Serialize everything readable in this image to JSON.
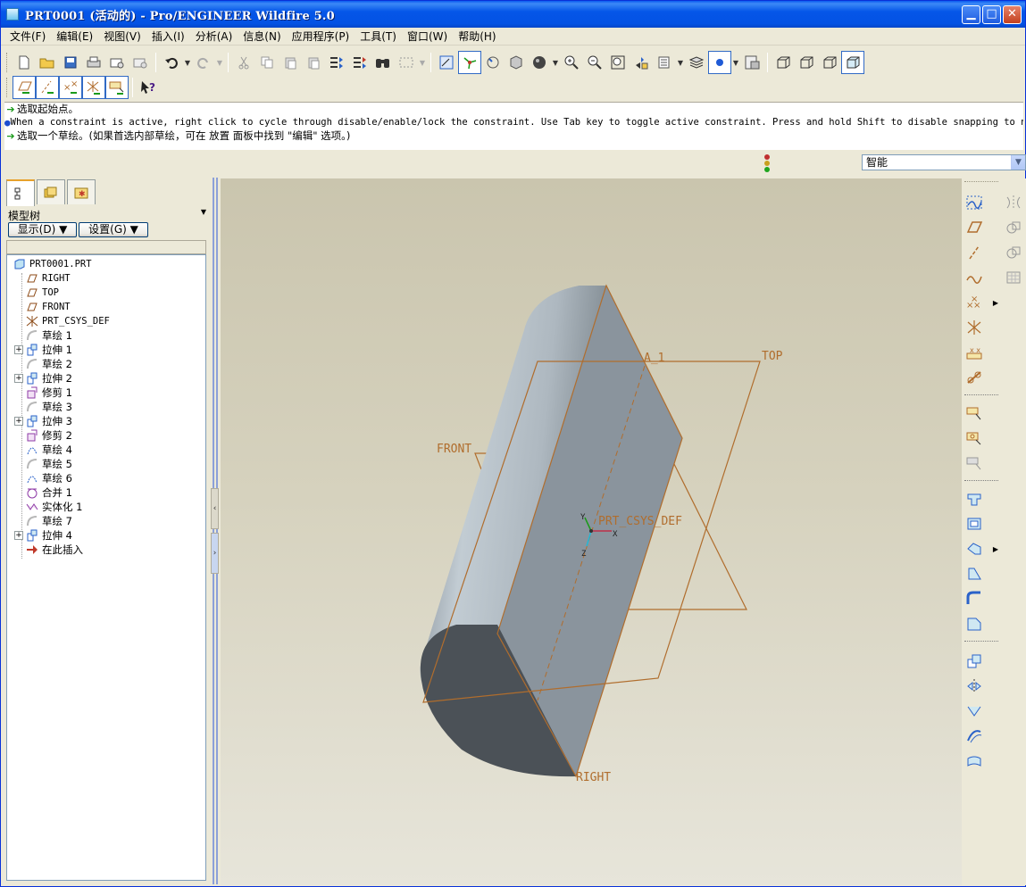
{
  "window": {
    "title": "PRT0001 (活动的) - Pro/ENGINEER Wildfire 5.0",
    "controls": [
      "minimize",
      "maximize",
      "close"
    ]
  },
  "menu": [
    "文件(F)",
    "编辑(E)",
    "视图(V)",
    "插入(I)",
    "分析(A)",
    "信息(N)",
    "应用程序(P)",
    "工具(T)",
    "窗口(W)",
    "帮助(H)"
  ],
  "toolbar": {
    "row1": [
      "new-icon",
      "open-icon",
      "save-icon",
      "print-icon",
      "email-icon",
      "email-link-icon",
      "undo-icon",
      "redo-icon",
      "cut-icon",
      "copy-icon",
      "paste-icon",
      "paste-special-icon",
      "regenerate-icon",
      "regen-manager-icon",
      "find-icon",
      "select-box-icon",
      "repaint-icon",
      "spin-center-icon",
      "orient-mode-icon",
      "view-manager-icon",
      "display-style-icon",
      "zoom-in-icon",
      "zoom-out-icon",
      "refit-icon",
      "reorient-icon",
      "saved-views-icon",
      "layers-icon",
      "appearance-icon",
      "model-setup-icon",
      "wireframe-icon",
      "hidden-line-icon",
      "no-hidden-icon",
      "shading-icon"
    ],
    "row2": [
      "datum-plane-display-icon",
      "datum-axis-display-icon",
      "datum-point-display-icon",
      "csys-display-icon",
      "annotation-display-icon",
      "context-help-icon"
    ]
  },
  "messages": [
    {
      "type": "prompt",
      "text": "选取起始点。"
    },
    {
      "type": "info",
      "text": "When a constraint is active, right click to cycle through disable/enable/lock the constraint. Use Tab key to toggle active constraint. Press and hold Shift to disable snapping to new cons"
    },
    {
      "type": "prompt",
      "text": "选取一个草绘。(如果首选内部草绘，可在 放置 面板中找到 \"编辑\" 选项。)"
    }
  ],
  "status": {
    "filter": "智能"
  },
  "navigator": {
    "title": "模型树",
    "show_button": "显示(D) ▼",
    "settings_button": "设置(G) ▼",
    "tree": [
      {
        "label": "PRT0001.PRT",
        "icon": "part-icon",
        "expand": false,
        "mono": true
      },
      {
        "label": "RIGHT",
        "icon": "datum-plane-icon",
        "expand": false,
        "mono": true
      },
      {
        "label": "TOP",
        "icon": "datum-plane-icon",
        "expand": false,
        "mono": true
      },
      {
        "label": "FRONT",
        "icon": "datum-plane-icon",
        "expand": false,
        "mono": true
      },
      {
        "label": "PRT_CSYS_DEF",
        "icon": "csys-icon",
        "expand": false,
        "mono": true
      },
      {
        "label": "草绘 1",
        "icon": "sketch-icon",
        "expand": false
      },
      {
        "label": "拉伸 1",
        "icon": "extrude-icon",
        "expand": true
      },
      {
        "label": "草绘 2",
        "icon": "sketch-icon",
        "expand": false
      },
      {
        "label": "拉伸 2",
        "icon": "extrude-icon",
        "expand": true
      },
      {
        "label": "修剪 1",
        "icon": "trim-icon",
        "expand": false
      },
      {
        "label": "草绘 3",
        "icon": "sketch-icon",
        "expand": false
      },
      {
        "label": "拉伸 3",
        "icon": "extrude-icon",
        "expand": true
      },
      {
        "label": "修剪 2",
        "icon": "trim-icon",
        "expand": false
      },
      {
        "label": "草绘 4",
        "icon": "sketch-curve-icon",
        "expand": false
      },
      {
        "label": "草绘 5",
        "icon": "sketch-icon",
        "expand": false
      },
      {
        "label": "草绘 6",
        "icon": "sketch-curve-icon",
        "expand": false
      },
      {
        "label": "合并 1",
        "icon": "merge-icon",
        "expand": false
      },
      {
        "label": "实体化 1",
        "icon": "solidify-icon",
        "expand": false
      },
      {
        "label": "草绘 7",
        "icon": "sketch-icon",
        "expand": false
      },
      {
        "label": "拉伸 4",
        "icon": "extrude-icon",
        "expand": true
      },
      {
        "label": "在此插入",
        "icon": "insert-here-arrow-icon",
        "expand": false
      }
    ]
  },
  "graphics": {
    "labels": {
      "top": "TOP",
      "front": "FRONT",
      "right": "RIGHT",
      "axis": "A_1",
      "csys": "PRT_CSYS_DEF",
      "x": "X",
      "y": "Y",
      "z": "Z"
    },
    "colors": {
      "datum": "#b06d2d",
      "body_light": "#a9b4bd",
      "body_dark": "#4b5157",
      "flat_face": "#8a949d"
    }
  },
  "right_toolbar": [
    "sketched-curve-icon",
    "datum-plane-tool-icon",
    "datum-axis-tool-icon",
    "curve-tool-icon",
    "datum-point-tool-icon",
    "csys-tool-icon",
    "analysis-feature-icon",
    "reference-feature-icon",
    "extrude-tool-icon",
    "revolve-tool-icon",
    "variable-section-sweep-icon",
    "hole-tool-icon",
    "shell-tool-icon",
    "rib-tool-icon",
    "draft-tool-icon",
    "round-tool-icon",
    "chamfer-tool-icon",
    "copy-tool-icon",
    "mirror-tool-icon",
    "merge-tool-icon",
    "trim-tool-icon",
    "pattern-tool-icon",
    "style-tool-icon",
    "boundary-blend-icon",
    "mirror-tool-right-icon",
    "intersect-icon",
    "project-icon",
    "offset-icon"
  ]
}
